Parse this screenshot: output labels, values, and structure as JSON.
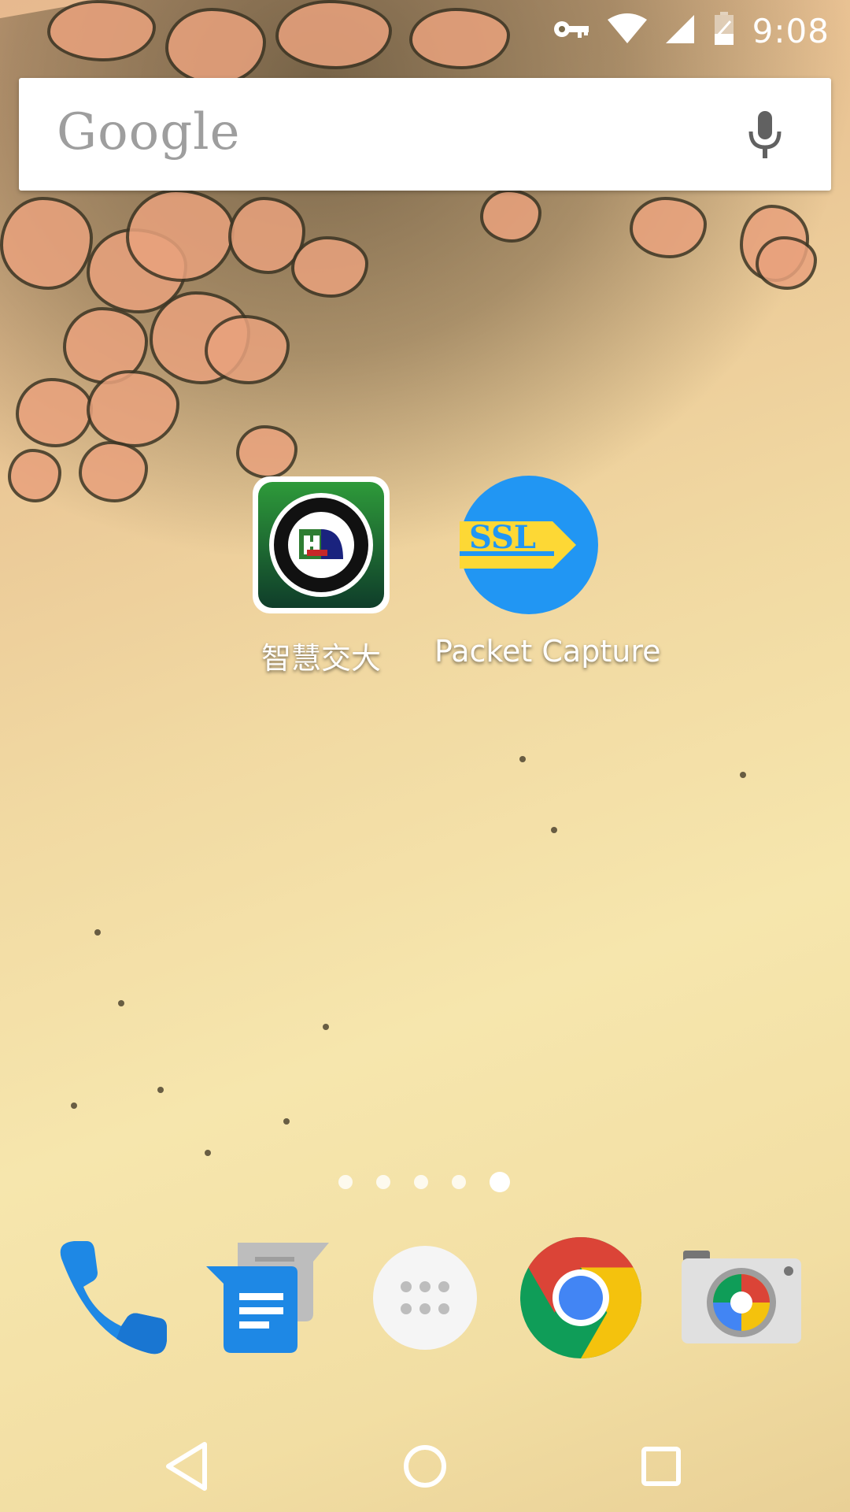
{
  "status_bar": {
    "time": "9:08",
    "icons": [
      "vpn-key-icon",
      "wifi-icon",
      "cell-signal-icon",
      "battery-icon"
    ]
  },
  "search": {
    "logo_text": "Google",
    "mic_icon": "microphone-icon"
  },
  "apps": [
    {
      "label": "智慧交大",
      "icon": "ecjtu-university-logo-icon"
    },
    {
      "label": "Packet Capture",
      "icon": "ssl-packet-capture-icon"
    }
  ],
  "page_indicator": {
    "count": 5,
    "active_index": 4
  },
  "dock": [
    {
      "name": "phone",
      "icon": "phone-icon"
    },
    {
      "name": "messages",
      "icon": "messages-icon"
    },
    {
      "name": "app-drawer",
      "icon": "app-drawer-icon"
    },
    {
      "name": "chrome",
      "icon": "chrome-icon"
    },
    {
      "name": "camera",
      "icon": "camera-icon"
    }
  ],
  "nav": [
    "back-icon",
    "home-icon",
    "recents-icon"
  ],
  "colors": {
    "phone_blue": "#1e88e5",
    "messages_blue": "#2196f3",
    "packet_capture_blue": "#2196f3",
    "packet_capture_yellow": "#fdd835",
    "chrome_red": "#db4437",
    "chrome_yellow": "#f4c20d",
    "chrome_green": "#0f9d58",
    "chrome_blue": "#4285f4"
  }
}
